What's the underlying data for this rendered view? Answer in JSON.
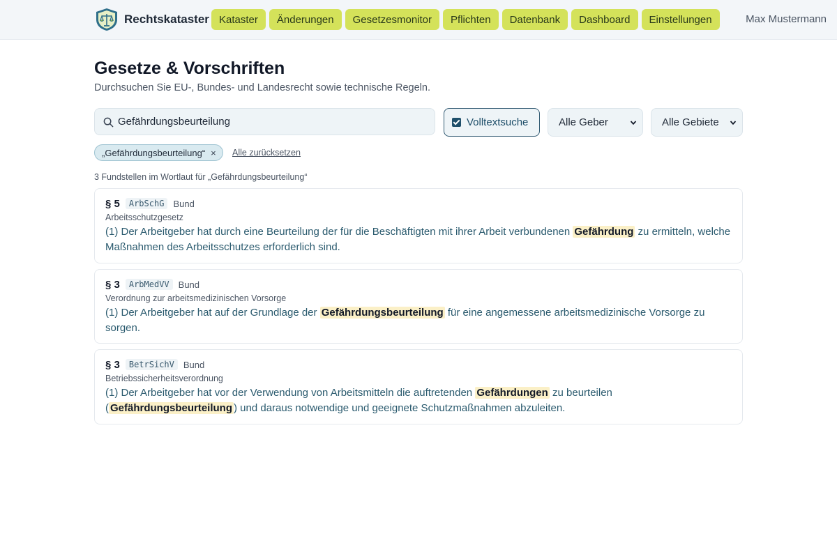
{
  "app": {
    "brand": "Rechtskataster",
    "user": "Max Mustermann"
  },
  "nav": [
    {
      "label": "Kataster"
    },
    {
      "label": "Änderungen"
    },
    {
      "label": "Gesetzesmonitor"
    },
    {
      "label": "Pflichten"
    },
    {
      "label": "Datenbank"
    },
    {
      "label": "Dashboard"
    },
    {
      "label": "Einstellungen"
    }
  ],
  "page": {
    "title": "Gesetze & Vorschriften",
    "subtitle": "Durchsuchen Sie EU-, Bundes- und Landesrecht sowie technische Regeln."
  },
  "search": {
    "value": "Gefährdungsbeurteilung"
  },
  "filters": {
    "fulltext_label": "Volltextsuche",
    "fulltext_checked": true,
    "geber": "Alle Geber",
    "gebiete": "Alle Gebiete"
  },
  "chips": {
    "active": "„Gefährdungsbeurteilung“",
    "remove": "×",
    "reset": "Alle zurücksetzen"
  },
  "results": {
    "summary": "3 Fundstellen im Wortlaut für „Gefährdungsbeurteilung“",
    "items": [
      {
        "para": "§ 5",
        "abbr": "ArbSchG",
        "level": "Bund",
        "name": "Arbeitsschutzgesetz",
        "text": [
          {
            "t": "(1) Der Arbeitgeber hat durch eine Beurteilung der für die Beschäftigten mit ihrer Arbeit verbundenen ",
            "hl": false
          },
          {
            "t": "Gefährdung",
            "hl": true
          },
          {
            "t": " zu ermitteln, welche Maßnahmen des Arbeitsschutzes erforderlich sind.",
            "hl": false
          }
        ]
      },
      {
        "para": "§ 3",
        "abbr": "ArbMedVV",
        "level": "Bund",
        "name": "Verordnung zur arbeitsmedizinischen Vorsorge",
        "text": [
          {
            "t": "(1) Der Arbeitgeber hat auf der Grundlage der ",
            "hl": false
          },
          {
            "t": "Gefährdungsbeurteilung",
            "hl": true
          },
          {
            "t": " für eine angemessene arbeitsmedizinische Vorsorge zu sorgen.",
            "hl": false
          }
        ]
      },
      {
        "para": "§ 3",
        "abbr": "BetrSichV",
        "level": "Bund",
        "name": "Betriebssicherheitsverordnung",
        "text": [
          {
            "t": "(1) Der Arbeitgeber hat vor der Verwendung von Arbeitsmitteln die auftretenden ",
            "hl": false
          },
          {
            "t": "Gefährdungen",
            "hl": true
          },
          {
            "t": " zu beurteilen (",
            "hl": false
          },
          {
            "t": "Gefährdungsbeurteilung",
            "hl": true
          },
          {
            "t": ") und daraus notwendige und geeignete Schutzmaßnahmen abzuleiten.",
            "hl": false
          }
        ]
      }
    ]
  },
  "colors": {
    "nav_bg": "#d4e25a",
    "accent": "#1f4f6a",
    "highlight": "#fbf0c7"
  }
}
